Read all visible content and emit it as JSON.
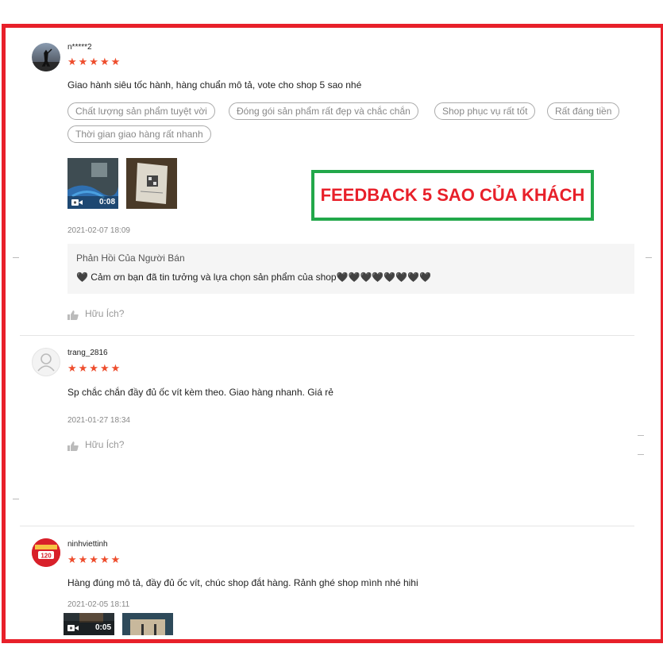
{
  "reviews": [
    {
      "username": "n*****2",
      "stars": "★★★★★",
      "comment": "Giao hành siêu tốc hành, hàng chuẩn mô tả, vote cho shop 5 sao nhé",
      "tags": [
        "Chất lượng sản phẩm tuyệt vời",
        "Đóng gói sản phẩm rất đẹp và chắc chắn",
        "Shop phục vụ rất tốt",
        "Rất đáng tiền",
        "Thời gian giao hàng rất nhanh"
      ],
      "video_duration": "0:08",
      "date": "2021-02-07 18:09",
      "seller_reply": {
        "title": "Phản Hồi Của Người Bán",
        "text": "🖤  Cảm ơn bạn đã tin tưởng và lựa chọn sản phẩm của shop🖤🖤🖤🖤🖤🖤🖤🖤"
      },
      "helpful": "Hữu Ích?"
    },
    {
      "username": "trang_2816",
      "stars": "★★★★★",
      "comment": "Sp chắc chắn đầy đủ ốc vít kèm theo. Giao hàng nhanh. Giá rẻ",
      "date": "2021-01-27 18:34",
      "helpful": "Hữu Ích?"
    },
    {
      "username": "ninhviettinh",
      "stars": "★★★★★",
      "comment": "Hàng đúng mô tả, đầy đủ ốc vít, chúc shop đắt hàng. Rảnh ghé shop mình nhé hihi",
      "date": "2021-02-05 18:11",
      "video_duration": "0:05",
      "avatar_badge": "120"
    }
  ],
  "overlay_banner": "FEEDBACK 5 SAO CỦA KHÁCH",
  "colors": {
    "frame": "#e8202a",
    "stars": "#ee4d2d",
    "banner_border": "#22a84a",
    "banner_text": "#e8202a"
  },
  "icons": {
    "like": "thumbs-up-icon",
    "video": "video-camera-icon",
    "default_avatar": "user-silhouette-icon"
  }
}
